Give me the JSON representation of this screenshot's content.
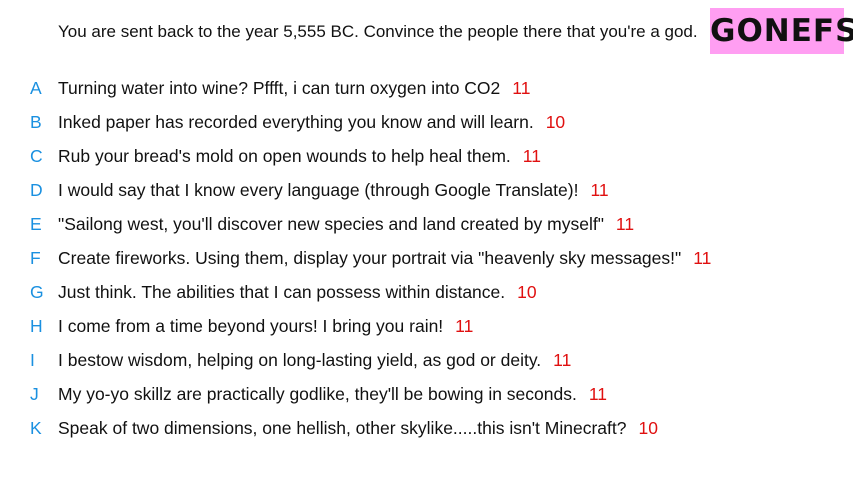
{
  "header": {
    "prompt": "You are sent back to the year 5,555 BC. Convince the people there that you're a god.",
    "logo": "GONEFS"
  },
  "colors": {
    "logo_bg": "#ff9ef2",
    "letter": "#1a90e0",
    "score": "#e01010"
  },
  "answers": [
    {
      "letter": "A",
      "text": "Turning water into wine? Pffft, i can turn oxygen into CO2",
      "score": "11"
    },
    {
      "letter": "B",
      "text": "Inked paper has recorded everything you know and will learn.",
      "score": "10"
    },
    {
      "letter": "C",
      "text": "Rub your bread's mold on open wounds to help heal them.",
      "score": "11"
    },
    {
      "letter": "D",
      "text": "I would say that I know every language (through Google Translate)!",
      "score": "11"
    },
    {
      "letter": "E",
      "text": "\"Sailong west, you'll discover new species and land created by myself\"",
      "score": "11"
    },
    {
      "letter": "F",
      "text": "Create fireworks. Using them, display your portrait via \"heavenly sky messages!\"",
      "score": "11"
    },
    {
      "letter": "G",
      "text": "Just think. The abilities that I can possess within distance.",
      "score": "10"
    },
    {
      "letter": "H",
      "text": "I come from a time beyond yours! I bring you rain!",
      "score": "11"
    },
    {
      "letter": "I",
      "text": "I bestow wisdom, helping on long-lasting yield, as god or deity.",
      "score": "11"
    },
    {
      "letter": "J",
      "text": "My yo-yo skillz are practically godlike, they'll be bowing in seconds.",
      "score": "11"
    },
    {
      "letter": "K",
      "text": "Speak of two dimensions, one hellish, other skylike.....this isn't Minecraft?",
      "score": "10"
    }
  ]
}
